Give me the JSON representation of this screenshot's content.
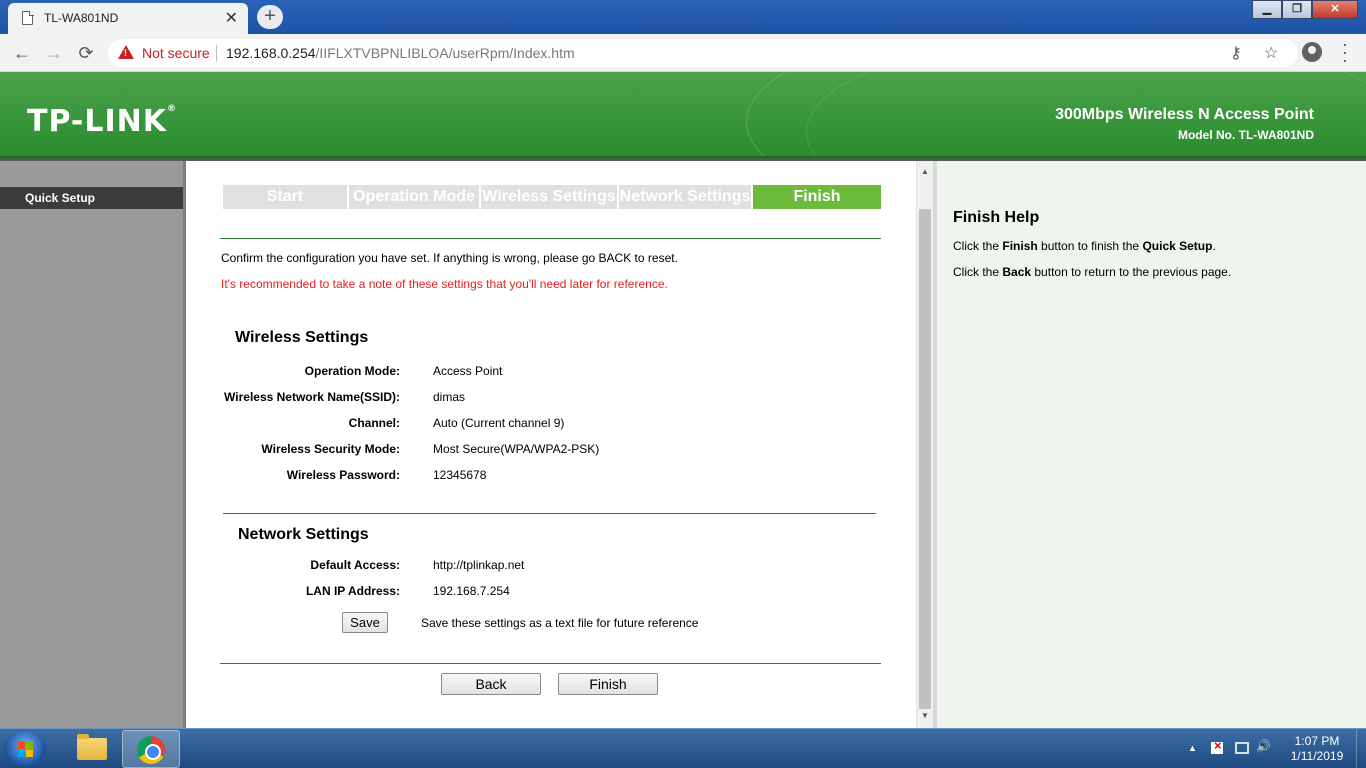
{
  "browser": {
    "tab_title": "TL-WA801ND",
    "tab_close": "✕",
    "new_tab": "+",
    "back": "←",
    "forward": "→",
    "reload": "⟳",
    "security_label": "Not secure",
    "url_host": "192.168.0.254",
    "url_path": "/IIFLXTVBPNLIBLOA/userRpm/Index.htm",
    "key_icon": "⚷",
    "star_icon": "☆",
    "win_min": "▁",
    "win_max": "❐",
    "win_close": "✕"
  },
  "header": {
    "logo": "TP-LINK",
    "logo_mark": "®",
    "product": "300Mbps Wireless N Access Point",
    "model": "Model No. TL-WA801ND"
  },
  "sidebar": {
    "items": [
      {
        "label": "Quick Setup",
        "active": true
      }
    ]
  },
  "steps": [
    {
      "label": "Start"
    },
    {
      "label": "Operation Mode"
    },
    {
      "label": "Wireless Settings"
    },
    {
      "label": "Network Settings"
    },
    {
      "label": "Finish"
    }
  ],
  "main": {
    "confirm_text": "Confirm the configuration you have set. If anything is wrong, please go BACK to reset.",
    "warning_text": "It's recommended to take a note of these settings that you'll need later for reference.",
    "wireless": {
      "heading": "Wireless Settings",
      "rows": [
        {
          "label": "Operation Mode:",
          "value": "Access Point"
        },
        {
          "label": "Wireless Network Name(SSID):",
          "value": "dimas"
        },
        {
          "label": "Channel:",
          "value": "Auto (Current channel 9)"
        },
        {
          "label": "Wireless Security Mode:",
          "value": "Most Secure(WPA/WPA2-PSK)"
        },
        {
          "label": "Wireless Password:",
          "value": "12345678"
        }
      ]
    },
    "network": {
      "heading": "Network Settings",
      "rows": [
        {
          "label": "Default Access:",
          "value": "http://tplinkap.net"
        },
        {
          "label": "LAN IP Address:",
          "value": "192.168.7.254"
        }
      ]
    },
    "save_button": "Save",
    "save_note": "Save these settings as a text file for future reference",
    "back_button": "Back",
    "finish_button": "Finish"
  },
  "help": {
    "title": "Finish Help",
    "line1": {
      "pre": "Click the ",
      "b1": "Finish",
      "mid": " button to finish the ",
      "b2": "Quick Setup",
      "post": "."
    },
    "line2": {
      "pre": "Click the ",
      "b1": "Back",
      "post": " button to return to the previous page."
    }
  },
  "taskbar": {
    "tray_up": "▲",
    "volume": "🔊",
    "time": "1:07 PM",
    "date": "1/11/2019"
  },
  "colors": {
    "brand_green": "#2a8b2e",
    "step_active": "#6dbb3b",
    "warning_red": "#e02020"
  }
}
